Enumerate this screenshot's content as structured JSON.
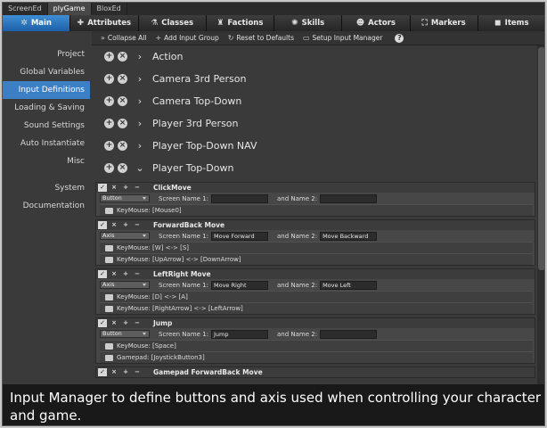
{
  "window_tabs": [
    "ScreenEd",
    "plyGame",
    "BloxEd"
  ],
  "main_tabs": [
    {
      "label": "Main",
      "icon": "gear-icon",
      "glyph": "✲"
    },
    {
      "label": "Attributes",
      "icon": "plus-icon",
      "glyph": "✚"
    },
    {
      "label": "Classes",
      "icon": "flask-icon",
      "glyph": "⚗"
    },
    {
      "label": "Factions",
      "icon": "castle-icon",
      "glyph": "♜"
    },
    {
      "label": "Skills",
      "icon": "skills-icon",
      "glyph": "✺"
    },
    {
      "label": "Actors",
      "icon": "actor-icon",
      "glyph": "☻"
    },
    {
      "label": "Markers",
      "icon": "markers-icon",
      "glyph": "⛶"
    },
    {
      "label": "Items",
      "icon": "items-icon",
      "glyph": "◼"
    }
  ],
  "sidebar": [
    "Project",
    "Global Variables",
    "Input Definitions",
    "Loading & Saving",
    "Sound Settings",
    "Auto Instantiate",
    "Misc",
    "System",
    "Documentation"
  ],
  "toolbar": {
    "collapse": "Collapse All",
    "add_group": "Add Input Group",
    "reset": "Reset to Defaults",
    "setup": "Setup Input Manager",
    "help": "?"
  },
  "groups": [
    "Action",
    "Camera 3rd Person",
    "Camera Top-Down",
    "Player 3rd Person",
    "Player Top-Down NAV",
    "Player Top-Down"
  ],
  "labels": {
    "screen_name_1": "Screen Name 1:",
    "and_name_2": "and Name 2:",
    "keymouse": "KeyMouse:",
    "gamepad": "Gamepad:"
  },
  "inputs": [
    {
      "name": "ClickMove",
      "type": "Button",
      "screen1": "",
      "screen2": "",
      "key": "[Mouse0]",
      "key2": ""
    },
    {
      "name": "ForwardBack Move",
      "type": "Axis",
      "screen1": "Move Forward",
      "screen2": "Move Backward",
      "key": "[W] <-> [S]",
      "key2": "[UpArrow] <-> [DownArrow]"
    },
    {
      "name": "LeftRight Move",
      "type": "Axis",
      "screen1": "Move Right",
      "screen2": "Move Left",
      "key": "[D] <-> [A]",
      "key2": "[RightArrow] <-> [LeftArrow]"
    },
    {
      "name": "Jump",
      "type": "Button",
      "screen1": "Jump",
      "screen2": "",
      "key": "[Space]",
      "gamepad": "[JoystickButton3]"
    },
    {
      "name": "Gamepad ForwardBack Move"
    }
  ],
  "caption": "Input Manager to define buttons and axis used when controlling your character and game."
}
